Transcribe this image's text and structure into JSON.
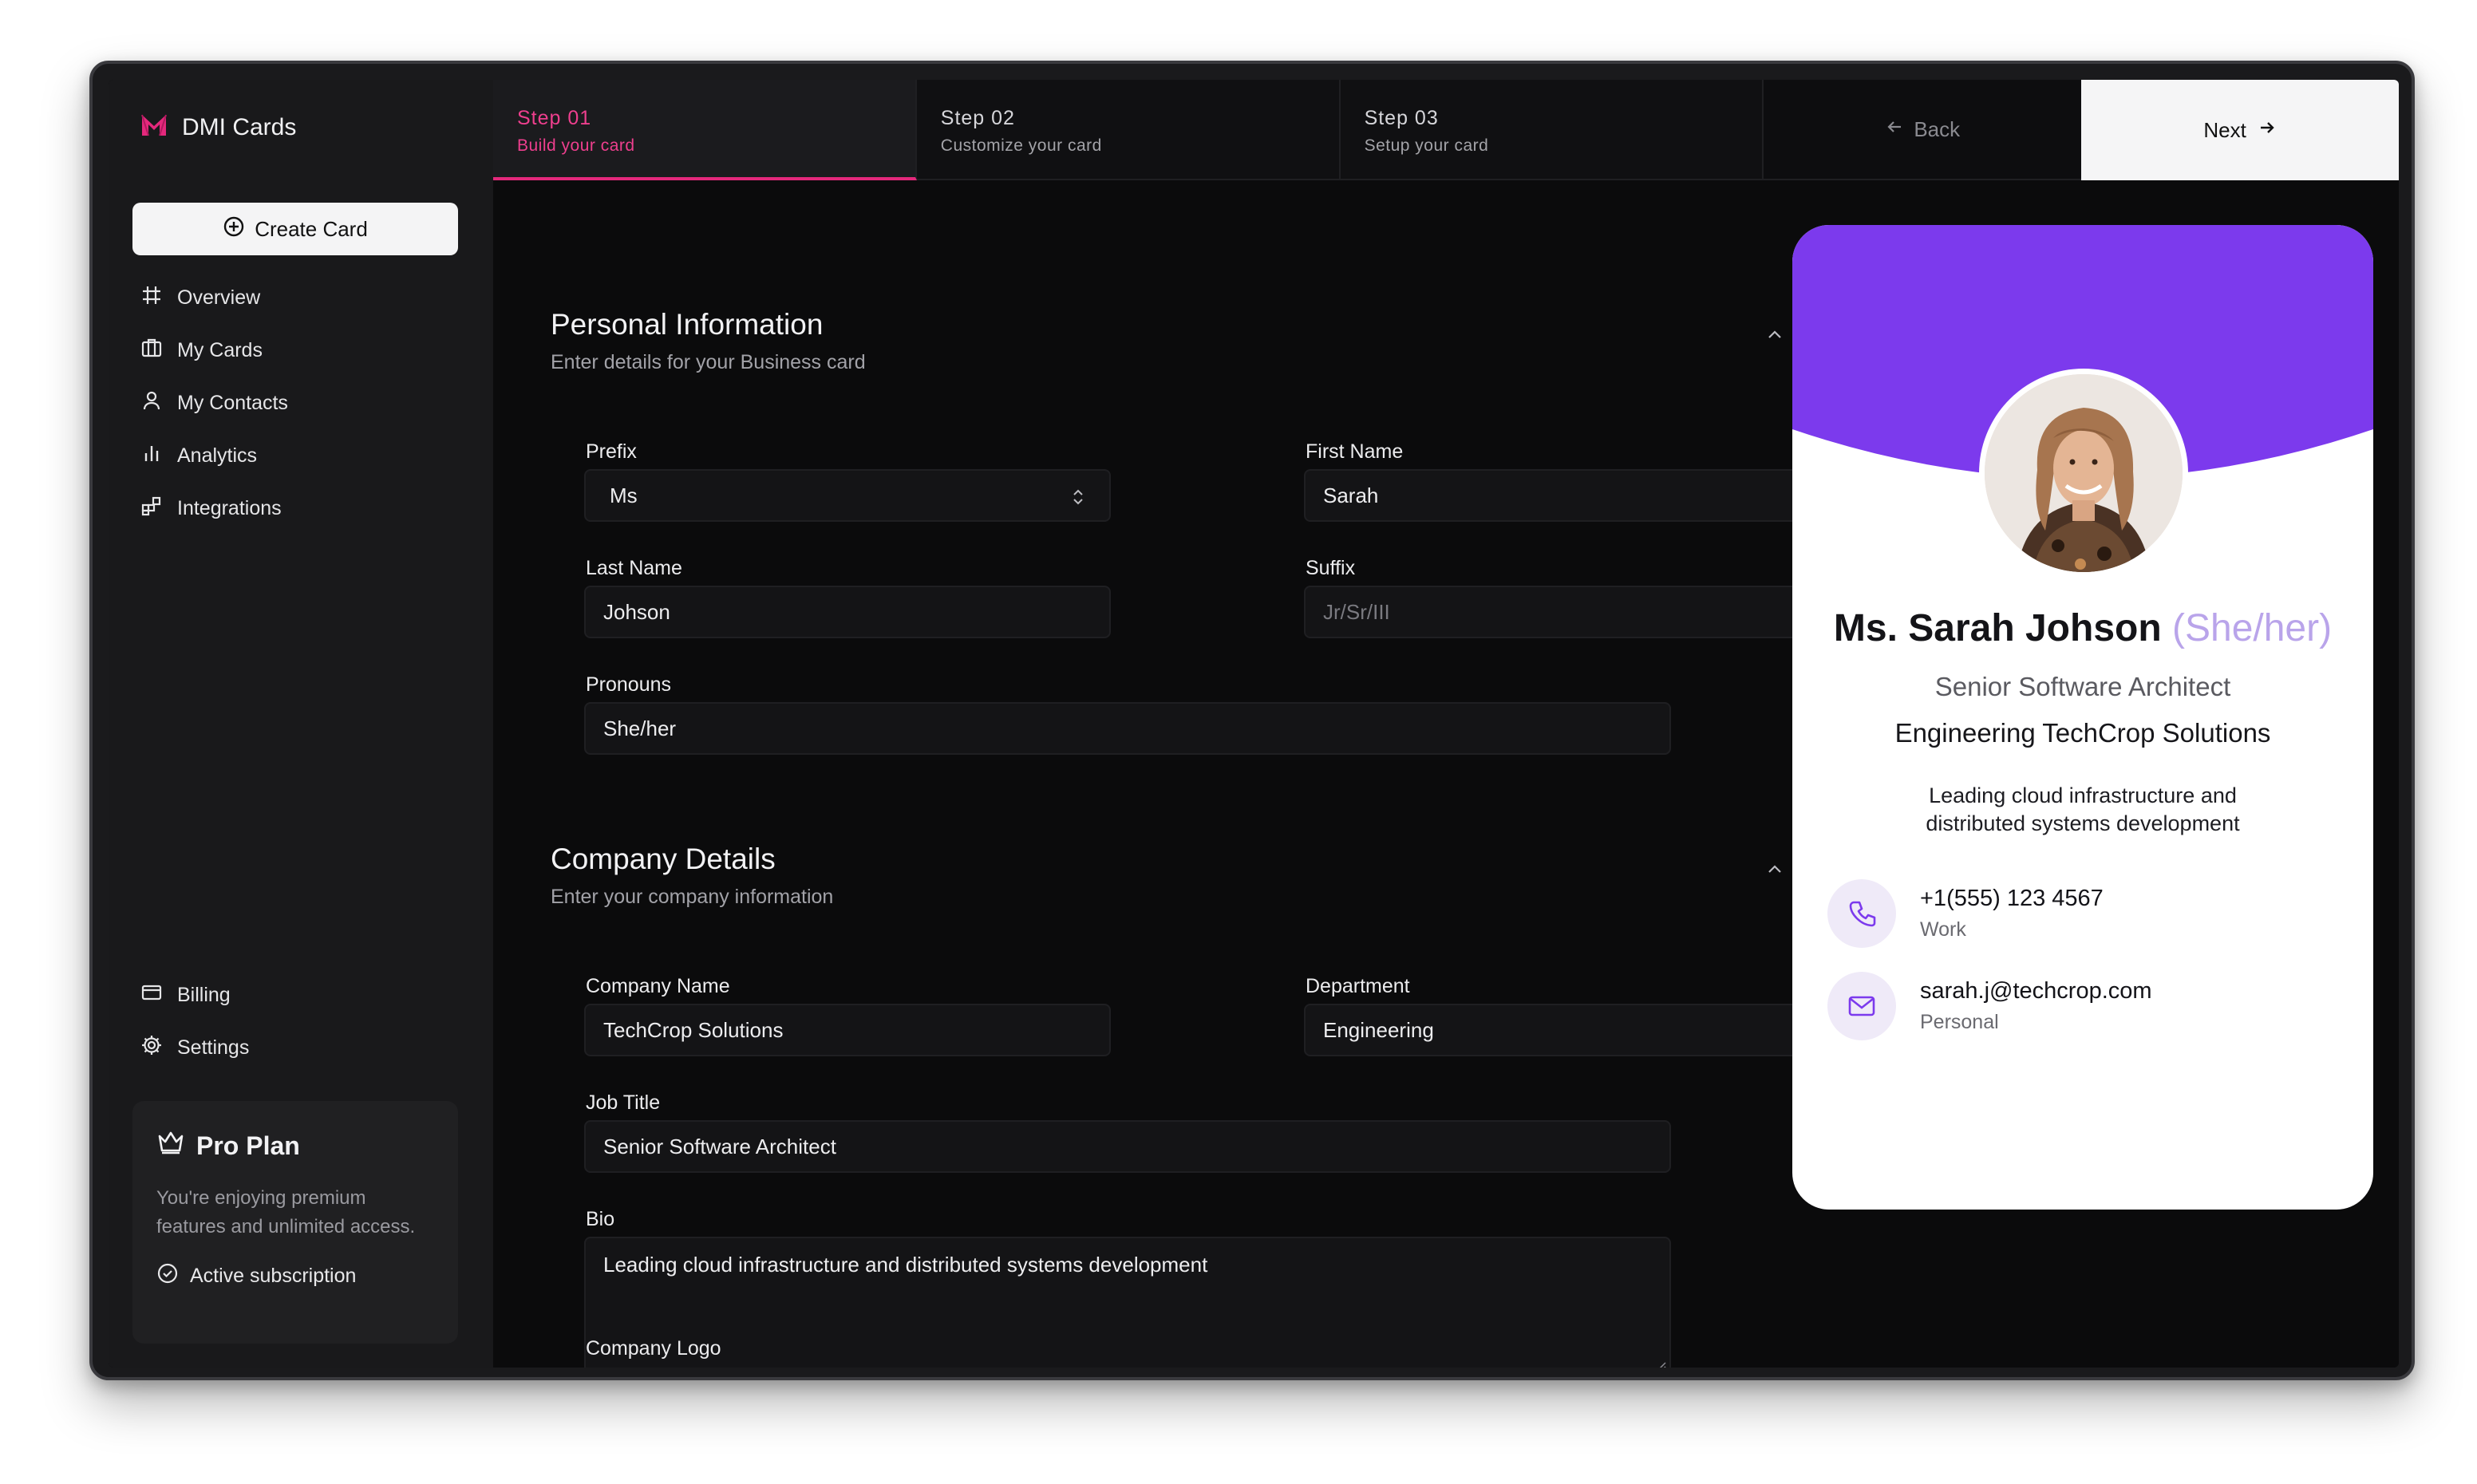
{
  "app": {
    "name": "DMI Cards",
    "brand_color": "#e4287c"
  },
  "sidebar": {
    "create_label": "Create Card",
    "items": [
      {
        "label": "Overview",
        "icon": "hash-icon"
      },
      {
        "label": "My Cards",
        "icon": "cards-icon"
      },
      {
        "label": "My Contacts",
        "icon": "user-icon"
      },
      {
        "label": "Analytics",
        "icon": "bar-chart-icon"
      },
      {
        "label": "Integrations",
        "icon": "blocks-icon"
      }
    ],
    "bottom_items": [
      {
        "label": "Billing",
        "icon": "credit-card-icon"
      },
      {
        "label": "Settings",
        "icon": "gear-icon"
      }
    ],
    "plan": {
      "title": "Pro Plan",
      "description": "You're enjoying premium features and unlimited access.",
      "status": "Active subscription"
    }
  },
  "steps": [
    {
      "number": "Step 01",
      "label": "Build your card",
      "active": true
    },
    {
      "number": "Step 02",
      "label": "Customize your card",
      "active": false
    },
    {
      "number": "Step 03",
      "label": "Setup your card",
      "active": false
    }
  ],
  "nav_buttons": {
    "back": "Back",
    "next": "Next"
  },
  "personal": {
    "title": "Personal Information",
    "subtitle": "Enter details for your Business card",
    "prefix_label": "Prefix",
    "prefix_value": "Ms",
    "first_name_label": "First Name",
    "first_name_value": "Sarah",
    "last_name_label": "Last Name",
    "last_name_value": "Johson",
    "suffix_label": "Suffix",
    "suffix_placeholder": "Jr/Sr/III",
    "pronouns_label": "Pronouns",
    "pronouns_value": "She/her"
  },
  "company": {
    "title": "Company Details",
    "subtitle": "Enter your company information",
    "company_name_label": "Company Name",
    "company_name_value": "TechCrop Solutions",
    "department_label": "Department",
    "department_value": "Engineering",
    "job_title_label": "Job Title",
    "job_title_value": "Senior Software Architect",
    "bio_label": "Bio",
    "bio_value": "Leading cloud infrastructure and distributed systems development",
    "logo_label": "Company Logo"
  },
  "preview": {
    "header_color": "#7c3aed",
    "name": "Ms. Sarah Johson",
    "pronouns": "(She/her)",
    "job_title": "Senior Software Architect",
    "company": "Engineering TechCrop Solutions",
    "bio": "Leading cloud infrastructure and distributed systems development",
    "phone": "+1(555) 123 4567",
    "phone_type": "Work",
    "email": "sarah.j@techcrop.com",
    "email_type": "Personal"
  }
}
